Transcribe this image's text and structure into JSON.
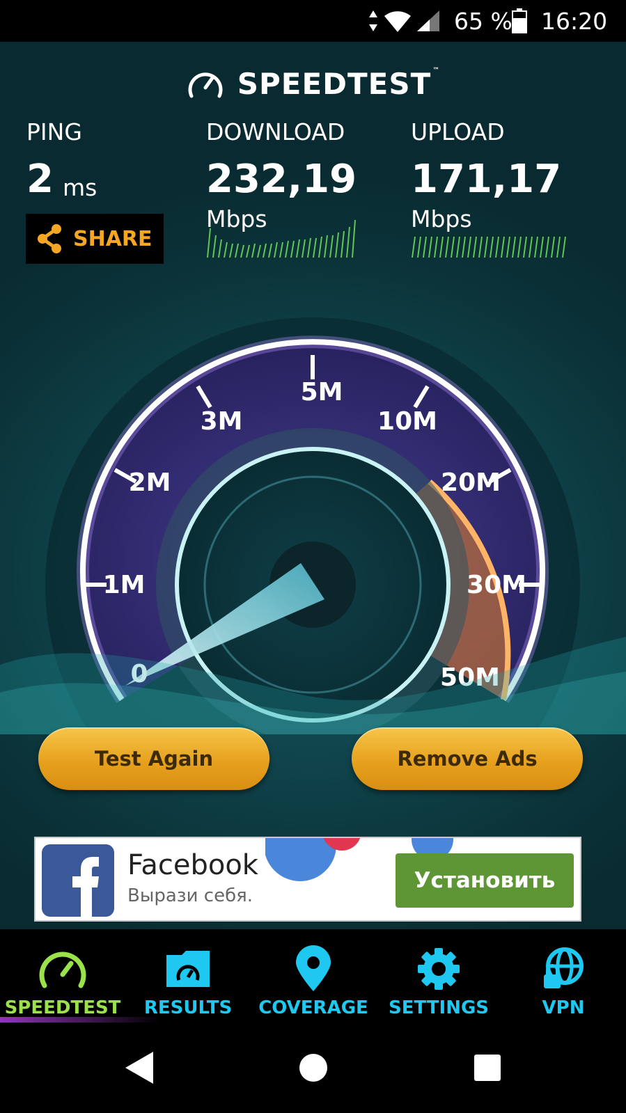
{
  "status_bar": {
    "battery_percent": "65 %",
    "time": "16:20",
    "icons": [
      "data-arrows-icon",
      "wifi-icon",
      "signal-icon",
      "battery-icon"
    ]
  },
  "app": {
    "logo_text": "SPEEDTEST",
    "trademark": "™"
  },
  "results": {
    "ping": {
      "label": "PING",
      "value": "2",
      "unit": "ms"
    },
    "download": {
      "label": "DOWNLOAD",
      "value": "232,19",
      "unit": "Mbps"
    },
    "upload": {
      "label": "UPLOAD",
      "value": "171,17",
      "unit": "Mbps"
    },
    "share_label": "SHARE"
  },
  "gauge": {
    "scale_labels": [
      "0",
      "1M",
      "2M",
      "3M",
      "5M",
      "10M",
      "20M",
      "30M",
      "50M"
    ],
    "colors": {
      "ring": "#ffffff",
      "dial_fill": "#3a2f7a",
      "overflow_zone": "#e8832a",
      "needle": "#9ff0ff"
    }
  },
  "actions": {
    "test_again": "Test Again",
    "remove_ads": "Remove Ads"
  },
  "ad": {
    "title": "Facebook",
    "subtitle": "Вырази себя.",
    "cta": "Установить",
    "cta_color": "#5e9636"
  },
  "tabs": [
    {
      "label": "SPEEDTEST",
      "icon": "speedometer-icon",
      "active": true
    },
    {
      "label": "RESULTS",
      "icon": "results-folder-icon",
      "active": false
    },
    {
      "label": "COVERAGE",
      "icon": "map-pin-icon",
      "active": false
    },
    {
      "label": "SETTINGS",
      "icon": "gear-icon",
      "active": false
    },
    {
      "label": "VPN",
      "icon": "globe-lock-icon",
      "active": false
    }
  ],
  "colors": {
    "accent_active": "#9be24a",
    "accent_tab": "#1ec8f0",
    "share_text": "#f5a623",
    "button_gold": "#e7a11e"
  }
}
